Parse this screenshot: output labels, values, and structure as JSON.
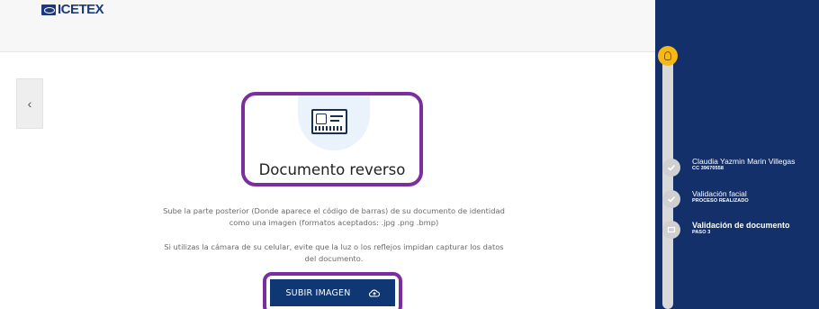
{
  "header": {
    "logo_text": "ICETEX"
  },
  "navigation": {
    "back_label": "‹"
  },
  "card": {
    "title": "Documento reverso",
    "icon": "id-card-icon"
  },
  "instructions": {
    "paragraph1": "Sube la parte posterior (Donde aparece el código de barras) de su documento de identidad como una imagen (formatos aceptados: .jpg .png .bmp)",
    "paragraph2": "Si utilizas la cámara de su celular, evite que la luz o los reflejos impidan capturar los datos del documento."
  },
  "upload": {
    "label": "SUBIR IMAGEN",
    "icon": "cloud-upload-icon"
  },
  "steps": [
    {
      "name": "Claudia Yazmin Marin Villegas",
      "sub": "CC 39670558",
      "state": "done"
    },
    {
      "name": "Validación facial",
      "sub": "PROCESO REALIZADO",
      "state": "done"
    },
    {
      "name": "Validación de documento",
      "sub": "PASO 3",
      "state": "active"
    }
  ],
  "colors": {
    "sidebar": "#13306b",
    "primary_button": "#0f3773",
    "highlight": "#7b2f9e",
    "progress_marker": "#f5b814"
  }
}
